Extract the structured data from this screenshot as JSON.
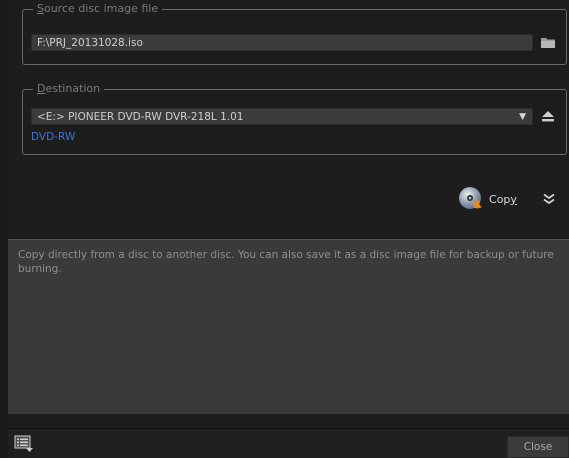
{
  "source": {
    "legend_first": "S",
    "legend_rest": "ource disc image file",
    "path": "F:\\PRJ_20131028.iso",
    "browse_icon": "folder-icon"
  },
  "destination": {
    "legend_first": "D",
    "legend_rest": "estination",
    "drive": "<E:>  PIONEER DVD-RW  DVR-218L 1.01",
    "media_type": "DVD-RW",
    "media_color": "#3f74d6",
    "eject_icon": "eject-icon"
  },
  "actions": {
    "copy_first": "C",
    "copy_rest": "op",
    "copy_underlined": "y",
    "expand_icon": "double-chevron-down-icon"
  },
  "info": {
    "text": "Copy directly from a disc to another disc. You can also save it as a disc image file for backup or future burning."
  },
  "footer": {
    "log_icon": "log-list-icon",
    "close_label": "Close"
  }
}
